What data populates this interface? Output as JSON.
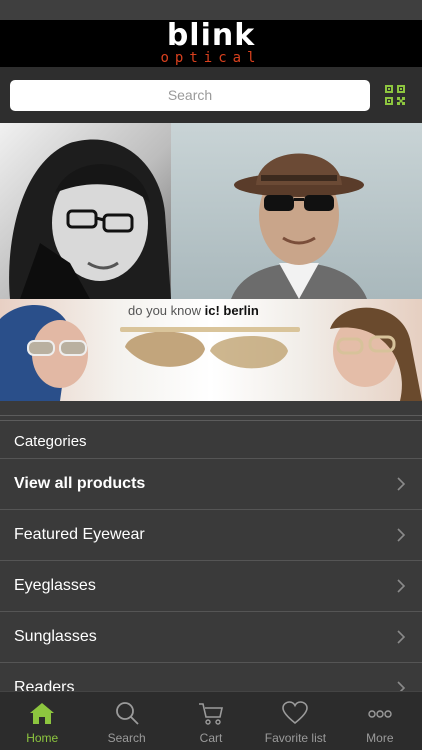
{
  "brand": {
    "logo": "blink",
    "sub": "optical"
  },
  "search": {
    "placeholder": "Search"
  },
  "banner": {
    "tagline_prefix": "do you know",
    "tagline_brand": "ic! berlin"
  },
  "categories": {
    "header": "Categories",
    "items": [
      {
        "label": "View all products",
        "bold": true
      },
      {
        "label": "Featured Eyewear"
      },
      {
        "label": "Eyeglasses"
      },
      {
        "label": "Sunglasses"
      },
      {
        "label": "Readers"
      }
    ]
  },
  "tabs": [
    {
      "label": "Home",
      "icon": "home-icon",
      "active": true
    },
    {
      "label": "Search",
      "icon": "search-icon"
    },
    {
      "label": "Cart",
      "icon": "cart-icon"
    },
    {
      "label": "Favorite list",
      "icon": "heart-icon"
    },
    {
      "label": "More",
      "icon": "more-icon"
    }
  ],
  "colors": {
    "accent": "#8dc63f",
    "brand_red": "#d8401e"
  }
}
